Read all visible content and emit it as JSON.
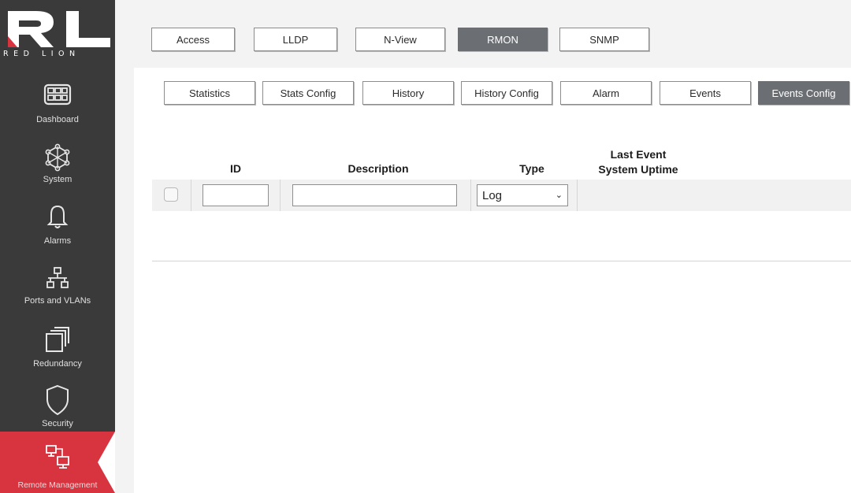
{
  "brand": {
    "logo_text": "RED LION"
  },
  "sidebar": {
    "items": [
      {
        "label": "Dashboard",
        "icon": "dashboard-icon"
      },
      {
        "label": "System",
        "icon": "system-icon"
      },
      {
        "label": "Alarms",
        "icon": "bell-icon"
      },
      {
        "label": "Ports and VLANs",
        "icon": "network-icon"
      },
      {
        "label": "Redundancy",
        "icon": "redundancy-icon"
      },
      {
        "label": "Security",
        "icon": "shield-icon"
      },
      {
        "label": "Remote Management",
        "icon": "remote-management-icon",
        "active": true
      }
    ]
  },
  "top_tabs": [
    {
      "label": "Access"
    },
    {
      "label": "LLDP"
    },
    {
      "label": "N-View"
    },
    {
      "label": "RMON",
      "active": true
    },
    {
      "label": "SNMP"
    }
  ],
  "sub_tabs": [
    {
      "label": "Statistics"
    },
    {
      "label": "Stats Config"
    },
    {
      "label": "History"
    },
    {
      "label": "History Config"
    },
    {
      "label": "Alarm"
    },
    {
      "label": "Events"
    },
    {
      "label": "Events Config",
      "active": true
    }
  ],
  "table": {
    "headers": {
      "id": "ID",
      "description": "Description",
      "type": "Type",
      "last_event_line1": "Last Event",
      "last_event_line2": "System Uptime"
    },
    "new_row": {
      "id_value": "",
      "description_value": "",
      "type_selected": "Log"
    }
  },
  "colors": {
    "sidebar_bg": "#3a3a3a",
    "active_nav": "#d8343f",
    "active_tab": "#6b6e73"
  }
}
